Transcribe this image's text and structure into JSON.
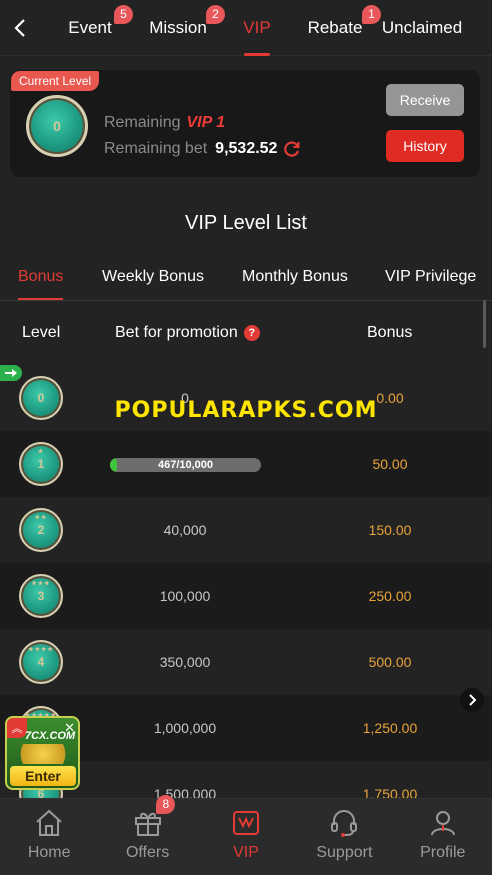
{
  "tabs": [
    {
      "label": "Event",
      "badge": "5"
    },
    {
      "label": "Mission",
      "badge": "2"
    },
    {
      "label": "VIP",
      "badge": ""
    },
    {
      "label": "Rebate",
      "badge": "1"
    },
    {
      "label": "Unclaimed",
      "badge": ""
    }
  ],
  "current": {
    "tag": "Current Level",
    "level": "0",
    "remaining_label": "Remaining",
    "remaining_vip": "VIP 1",
    "remaining_bet_label": "Remaining bet",
    "remaining_bet_value": "9,532.52",
    "receive_label": "Receive",
    "history_label": "History"
  },
  "list_title": "VIP Level List",
  "subtabs": [
    "Bonus",
    "Weekly Bonus",
    "Monthly Bonus",
    "VIP Privilege"
  ],
  "table": {
    "headers": {
      "level": "Level",
      "bet": "Bet for promotion",
      "bet_help": "?",
      "bonus": "Bonus"
    },
    "rows": [
      {
        "level": "0",
        "bet": "0",
        "bonus": "0.00",
        "stars": ""
      },
      {
        "level": "1",
        "bet": "467/10,000",
        "progress": 0.0467,
        "bonus": "50.00",
        "stars": "★"
      },
      {
        "level": "2",
        "bet": "40,000",
        "bonus": "150.00",
        "stars": "★★"
      },
      {
        "level": "3",
        "bet": "100,000",
        "bonus": "250.00",
        "stars": "★★★"
      },
      {
        "level": "4",
        "bet": "350,000",
        "bonus": "500.00",
        "stars": "★★★★"
      },
      {
        "level": "5",
        "bet": "1,000,000",
        "bonus": "1,250.00",
        "stars": "★★★★★"
      },
      {
        "level": "6",
        "bet": "1,500,000",
        "bonus": "1,750.00",
        "stars": "★"
      }
    ]
  },
  "watermark": "POPULARAPKS.COM",
  "ad": {
    "brand": "7CX.COM",
    "enter": "Enter"
  },
  "bottom_nav": [
    {
      "label": "Home",
      "icon": "home-icon"
    },
    {
      "label": "Offers",
      "icon": "gift-icon",
      "badge": "8"
    },
    {
      "label": "VIP",
      "icon": "crown-icon"
    },
    {
      "label": "Support",
      "icon": "headset-icon"
    },
    {
      "label": "Profile",
      "icon": "user-icon"
    }
  ],
  "colors": {
    "accent": "#e23b35",
    "bonus": "#e8a43a",
    "progress": "#3fc33a"
  }
}
